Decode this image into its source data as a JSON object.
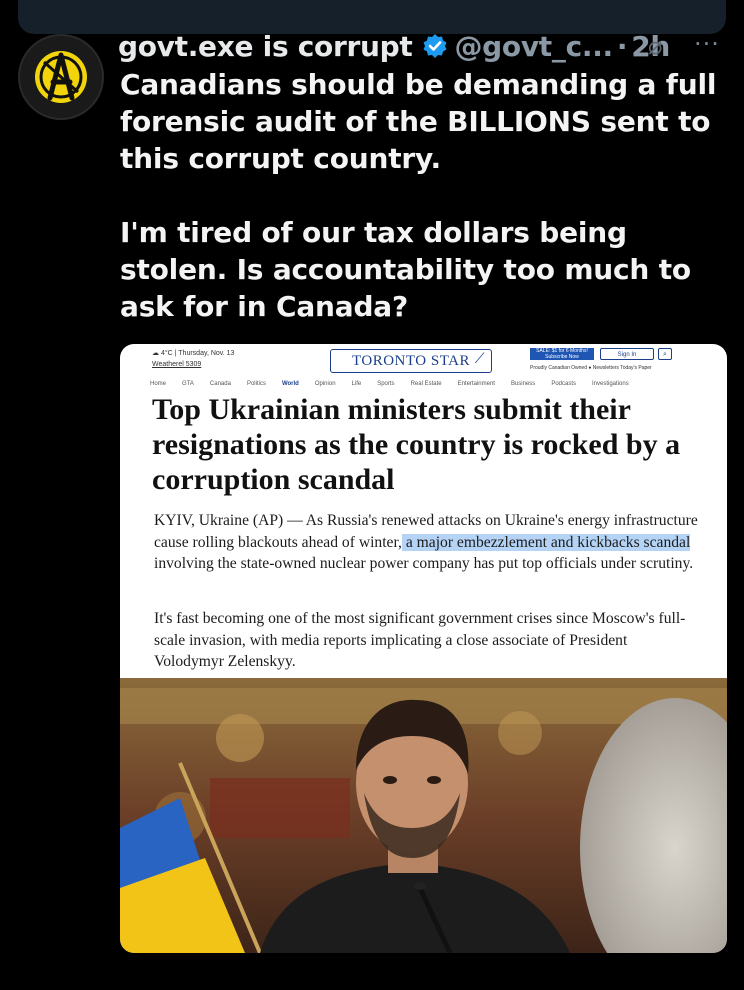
{
  "tweet": {
    "display_name": "govt.exe is corrupt",
    "handle": "@govt_c...",
    "separator": "·",
    "time": "2h",
    "more": "···",
    "paragraphs": [
      "Canadians should be demanding a full forensic audit of the BILLIONS sent to this corrupt country.",
      "I'm tired of our tax dollars being stolen. Is accountability too much to ask for in Canada?"
    ]
  },
  "article": {
    "weather": "4°C | Thursday, Nov. 13",
    "weather_link": "Weatherel 5309",
    "logo": "TORONTO STAR",
    "sale_label": "SALE: $1 for 6 Months! Subscribe Now",
    "signin_label": "Sign In",
    "subline": "Proudly Canadian Owned  ●  Newsletters   Today's Paper",
    "nav": [
      "Home",
      "GTA",
      "Canada",
      "Politics",
      "World",
      "Opinion",
      "Life",
      "Sports",
      "Real Estate",
      "Entertainment",
      "Business",
      "Podcasts",
      "Investigations"
    ],
    "nav_active": "World",
    "headline": "Top Ukrainian ministers submit their resignations as the country is rocked by a corruption scandal",
    "lede_before": "KYIV, Ukraine (AP) — As Russia's renewed attacks on Ukraine's energy infrastructure cause rolling blackouts ahead of winter,",
    "lede_highlight": " a major embezzlement and kickbacks scandal",
    "lede_after": " involving the state-owned nuclear power company has put top officials under scrutiny.",
    "paragraph2": "It's fast becoming one of the most significant government crises since Moscow's full-scale invasion, with media reports implicating a close associate of President Volodymyr Zelenskyy."
  },
  "colors": {
    "background": "#000000",
    "verified_blue": "#1d9bf0",
    "highlight": "#b4d3f5",
    "star_blue": "#1b3f8c"
  }
}
